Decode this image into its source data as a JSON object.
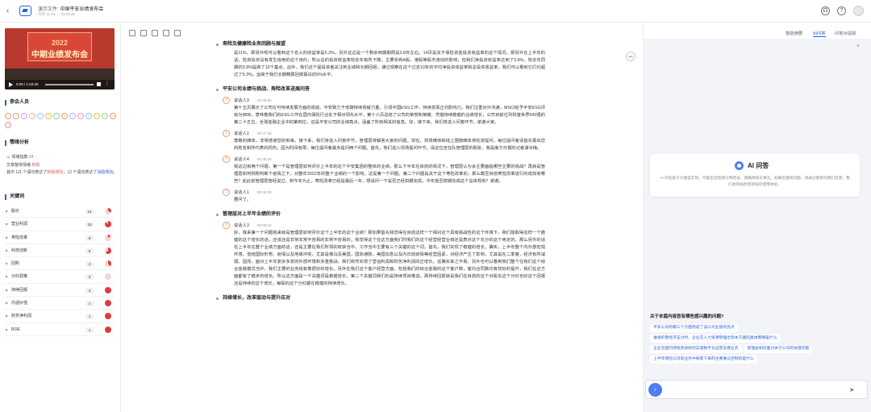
{
  "header": {
    "back_glyph": "‹",
    "doc_label": "演示文件:",
    "doc_name": "中国平安业绩发布会",
    "meta_date": "今天 11:15",
    "meta_duration": "01:03:26",
    "icons": [
      "headset-icon",
      "help-icon",
      "user-avatar"
    ]
  },
  "video": {
    "year": "2022",
    "title": "中期业绩发布会",
    "time": "0:00 / 1:03:26"
  },
  "participants": {
    "title": "参会人员",
    "list": [
      {
        "label": "1",
        "color": "#e29c7a"
      },
      {
        "label": "2",
        "color": "#e29c7a"
      },
      {
        "label": "3",
        "color": "#c9a6e0"
      },
      {
        "label": "4",
        "color": "#f0b4a6"
      },
      {
        "label": "5",
        "color": "#a8c8f0"
      },
      {
        "label": "6",
        "color": "#e6c05a"
      },
      {
        "label": "7",
        "color": "#8fd0a8"
      },
      {
        "label": "8",
        "color": "#e29c7a"
      },
      {
        "label": "9",
        "color": "#b4b4e6"
      },
      {
        "label": "10",
        "color": "#e0a0c8"
      },
      {
        "label": "11",
        "color": "#8fc8e0"
      },
      {
        "label": "12",
        "color": "#e6c05a"
      },
      {
        "label": "13",
        "color": "#a8d08f"
      },
      {
        "label": "14",
        "color": "#e29c7a"
      },
      {
        "label": "15",
        "color": "#d0a0a0"
      }
    ]
  },
  "sentiment": {
    "title": "情绪分析",
    "index_label": "情绪指数",
    "index_value": "24",
    "overall_label": "文章整体情绪",
    "overall_value": "积极",
    "summary_prefix": "其中 111 个语句表达了",
    "summary_neg": "积极倾向",
    "summary_mid": "，13 个语句表达了",
    "summary_neu": "消极倾向",
    "summary_suffix": "。"
  },
  "keywords": {
    "title": "关键词",
    "items": [
      {
        "name": "股价",
        "count": "14",
        "ratio": 0.3
      },
      {
        "name": "营业利润",
        "count": "10",
        "ratio": 0.85
      },
      {
        "name": "寿险改革",
        "count": "8",
        "ratio": 0.15
      },
      {
        "name": "科技创新",
        "count": "9",
        "ratio": 0.65
      },
      {
        "name": "回购",
        "count": "4",
        "ratio": 0.4
      },
      {
        "name": "分红政策",
        "count": "3",
        "ratio": 0.0
      },
      {
        "name": "持续回报",
        "count": "3",
        "ratio": 1.0
      },
      {
        "name": "内涵价值",
        "count": "1",
        "ratio": 1.0
      },
      {
        "name": "财务净利润",
        "count": "1",
        "ratio": 1.0
      },
      {
        "name": "ROE",
        "count": "1",
        "ratio": 1.0
      }
    ]
  },
  "main": {
    "toolbar_icons": [
      "doc-icon",
      "list-icon",
      "export-icon",
      "loop-icon",
      "copy-icon"
    ],
    "sections": [
      {
        "heading": "寿险及健康险业务回顾与展望",
        "blocks": [
          {
            "type": "para",
            "text": "是11%，那另外呢可以看到这个名义的收益率是5.2%，另外这边是一个剩余到期期限是3.8年左右。14页是关于保险资金投资收益率的这个情况，那另外在上半年的话，险资投资没有发生信用的这个违约，所以总的投资收益率较去年有所下降，主要受到A股、港股等股市波动的影响，但我们净投资收益率达到了3.9%，较去年同期的3.8%提高了10个基点。此外，我们这个提投资者关注到业绩和长期回报，通过观察在这个过去10年的平均净投资收益率和总投资收益率，我们可以看到它们均超过了5.3%，远高于我们长期精算回报假设的5%水平。"
          }
        ]
      },
      {
        "heading": "平安公司业绩与挑战、寿险改革进展问答",
        "blocks": [
          {
            "type": "spk",
            "icon": "3",
            "speaker": "说话人3",
            "time": "00:06:50",
            "text": "第十五页展示了公司在可持续发展方面的成就。平安致力于低碳持续贡献力量，引领中国ESG工作，持续发挥正向影响力。我们注重对外沟通，MSCI给予平安ESG评级为BBB，意味着我们的ESG工作在国内保险行业处于相对领先水平。第十六页总结了公司的荣誉和荣耀，凭借持续稳健的业绩增长，公司目前位列财富世界500强的第二十五位，全球金融企业中的第四位，这是平安公司的业绩亮点，涵盖了所有相关的信息。好，接下来，我们将进入问答环节，谢谢大家。"
          },
          {
            "type": "spk",
            "icon": "1",
            "speaker": "说话人1",
            "time": "00:07:56",
            "text": "尊敬的媒体，非常感谢您的到来。接下来，我们将进入问答环节，管理层将解答大家的问题。现在，现场媒体和线上围脖媒体将轮流提问，每位提问者请首先报出您的姓名和所代表的机构，因为时间有限，每位提问者最多提问两个问题。首先，我们进入现场提问环节，请这位坐在队管理层的朋友，我是南方日报的记者谭冰梅。"
          },
          {
            "type": "spk",
            "icon": "4",
            "speaker": "说话人4",
            "time": "00:08:36",
            "text": "我这边有两个问题，第一个是管理层如何评价上半年的这个平安集团的整体的业绩，那么下半年在目前的情况下，管理层认为会主要面临哪些主要的挑战？再就是管理层如何刚刚判断个疫情之下，对整年2022年的整个业绩的一个影响，这是第一个问题。第二个问题是关于这个寿险改革的，那么截至目前寿险改革进行的成效有哪些？此此前管理层曾经说过，到今年为止，寿险改革已经是最后一年，想请问一下是否已经如期完成，今年能否按期完成这个总体规划？谢谢。"
          },
          {
            "type": "spk",
            "icon": "1",
            "speaker": "说话人1",
            "time": "00:09:23",
            "text": "要问了。"
          }
        ]
      },
      {
        "heading": "管理层对上半年业绩的评价",
        "blocks": [
          {
            "type": "spk",
            "icon": "3",
            "speaker": "说话人3",
            "time": "00:09:24",
            "text": "好，我来第一个问题我来就是管理层如何评价这个上半年的这个业绩？那如果首先我觉得在目前这样一个相对这个具有挑战性的这个环境下，我们能取得这样一个稳健的这个增长的话，应该还是非常非常不容易的非常不容易的，我觉得这个在这方面我们时我们的这个经营经营业绩还是表示这个充分的这个肯定的。那么另外的话在上半年在整个业绩方面的话，还是主要在我们所领的收获当中，工作当中主要有三个关键的这个词，首先，我们实现了稳健的增长。确实，上半年整个内外部宏观环境，但结国际形势、疫情以及地缘冲突，尤其是俄乌及美国，国际通胀，美国加息以及内日前疫情等经营因素，对经济产生了影响，尤其是在二季度，经济有所减弱。因而，面对上半年复杂多变的外部环境和多重挑战，我们依然实现了营运利润和财务净利润的正增长。这确实来之不易。另外也可以看到我们整个在我们这个综合金融模式当中，我们主要的业务线有着很好的增长。另外在我们这个客户经营方面，包括我们的综合金融的这个客户数，客均合同数均有较好的提升，我们在这方面都有了稳步的增长。所以这方面是一个关键词是稳健增长，第二个关键词我们的是持续项目推进，那持续回报就是我们在目前的这个对股东这个分红也好这个回报还是持续的这个增长，每股的这个分红都在稳健的持续增长。"
          }
        ]
      },
      {
        "heading": "持续增长，改革驱动与提升应对",
        "blocks": []
      }
    ]
  },
  "right": {
    "tabs": [
      "智能摘要",
      "AI问答",
      "问答对提取"
    ],
    "active_tab": 1,
    "ai_title": "AI 问答",
    "ai_desc": "AI 问答基于大模型实现，可能出出现部分和错误，请确保核实事实。如果您遇到问题，请通过重新问我们反馈，我们会持续改善持续的使用体验。",
    "question_title": "关于本篇内容您有哪些感兴趣的问题?",
    "chips": [
      "平安公司的哪三个方面构成了该公司业绩的亮点",
      "谁组织者经济压力时，企业在人力资源管理出现本方面的具体策略是什么",
      "企业在国内持续改进如何实施数字化运营支撑业务",
      "管理层如何面对关于公司的关键问题",
      "上半年保险公司就业务中探索下来的主要难以控制的是什么"
    ],
    "input_placeholder": ""
  }
}
